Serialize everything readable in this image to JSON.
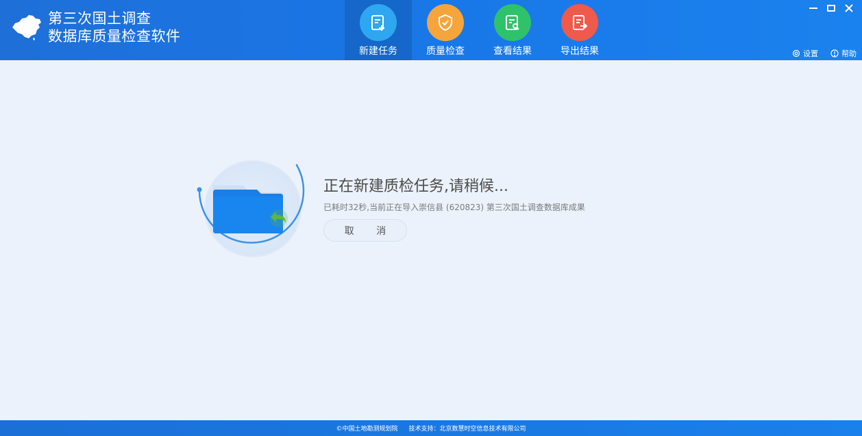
{
  "app": {
    "title_line1": "第三次国土调查",
    "title_line2": "数据库质量检查软件"
  },
  "nav": {
    "items": [
      {
        "label": "新建任务",
        "icon": "new-task-icon",
        "color": "#2ea7f0",
        "active": true
      },
      {
        "label": "质量检查",
        "icon": "shield-check-icon",
        "color": "#f5a53b",
        "active": false
      },
      {
        "label": "查看结果",
        "icon": "view-result-icon",
        "color": "#2ec36a",
        "active": false
      },
      {
        "label": "导出结果",
        "icon": "export-icon",
        "color": "#ef5a4b",
        "active": false
      }
    ]
  },
  "utility": {
    "settings_label": "设置",
    "help_label": "帮助"
  },
  "progress": {
    "title": "正在新建质检任务,请稍候...",
    "detail": "已耗时32秒,当前正在导入崇信县 (620823) 第三次国土调查数据库成果",
    "cancel_label": "取 消"
  },
  "footer": {
    "copyright": "©中国土地勘测规划院",
    "support": "技术支持：北京数慧时空信息技术有限公司"
  },
  "colors": {
    "header": "#1976e6",
    "background": "#ecf2fb",
    "folder": "#1a7ee8",
    "arrow": "#5cb83a"
  }
}
